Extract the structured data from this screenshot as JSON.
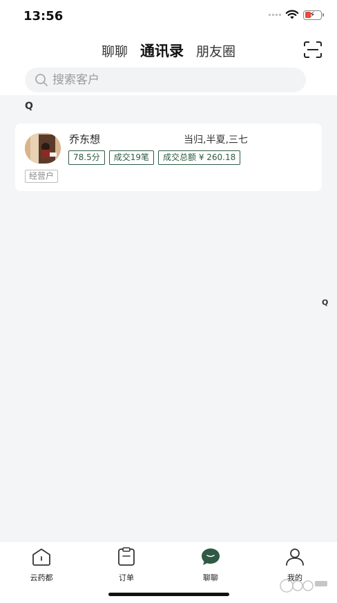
{
  "status_bar": {
    "time": "13:56"
  },
  "header": {
    "tabs": [
      {
        "label": "聊聊",
        "active": false
      },
      {
        "label": "通讯录",
        "active": true
      },
      {
        "label": "朋友圈",
        "active": false
      }
    ],
    "scan_icon": "scan-icon"
  },
  "search": {
    "placeholder": "搜索客户",
    "value": ""
  },
  "contacts": {
    "section_letter": "Q",
    "index_letter": "Q",
    "items": [
      {
        "name": "乔东想",
        "products": "当归,半夏,三七",
        "score": "78.5分",
        "deals": "成交19笔",
        "total": "成交总额 ¥ 260.18",
        "type": "经营户"
      }
    ]
  },
  "bottom_nav": [
    {
      "label": "云药都",
      "icon": "home-icon"
    },
    {
      "label": "订单",
      "icon": "order-icon"
    },
    {
      "label": "聊聊",
      "icon": "chat-icon",
      "active": true
    },
    {
      "label": "我的",
      "icon": "profile-icon"
    }
  ],
  "colors": {
    "accent": "#2f5a44",
    "background": "#f4f5f6"
  }
}
